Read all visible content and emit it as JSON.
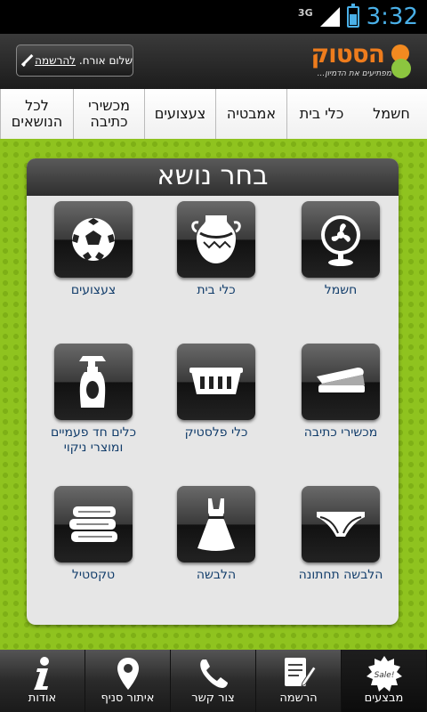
{
  "status": {
    "network": "3G",
    "time": "3:32"
  },
  "header": {
    "greeting": "שלום אורח.",
    "register_link": "להרשמה",
    "logo_text": "הסטוק",
    "logo_tagline": "מפתיעים את הדמיון..."
  },
  "tabs": [
    {
      "label": "חשמל"
    },
    {
      "label": "כלי בית"
    },
    {
      "label": "אמבטיה"
    },
    {
      "label": "צעצועים"
    },
    {
      "label": "מכשירי\nכתיבה"
    },
    {
      "label": "לכל\nהנושאים"
    }
  ],
  "panel": {
    "title": "בחר נושא"
  },
  "topics": [
    {
      "label": "חשמל",
      "icon": "fan-icon"
    },
    {
      "label": "כלי בית",
      "icon": "vase-icon"
    },
    {
      "label": "צעצועים",
      "icon": "soccer-ball-icon"
    },
    {
      "label": "מכשירי כתיבה",
      "icon": "stapler-icon"
    },
    {
      "label": "כלי פלסטיק",
      "icon": "basket-icon"
    },
    {
      "label": "כלים חד פעמיים\nומוצרי ניקוי",
      "icon": "spray-bottle-icon"
    },
    {
      "label": "הלבשה תחתונה",
      "icon": "underwear-icon"
    },
    {
      "label": "הלבשה",
      "icon": "dress-icon"
    },
    {
      "label": "טקסטיל",
      "icon": "towels-icon"
    }
  ],
  "bottom_nav": [
    {
      "label": "אודות",
      "icon": "info-icon"
    },
    {
      "label": "איתור סניף",
      "icon": "map-pin-icon"
    },
    {
      "label": "צור קשר",
      "icon": "phone-icon"
    },
    {
      "label": "הרשמה",
      "icon": "form-icon"
    },
    {
      "label": "מבצעים",
      "icon": "sale-icon"
    }
  ],
  "colors": {
    "accent_blue": "#4ab0e8",
    "logo_orange": "#ee7c1d",
    "background_green": "#8fc31f",
    "topic_label": "#123d6b"
  }
}
